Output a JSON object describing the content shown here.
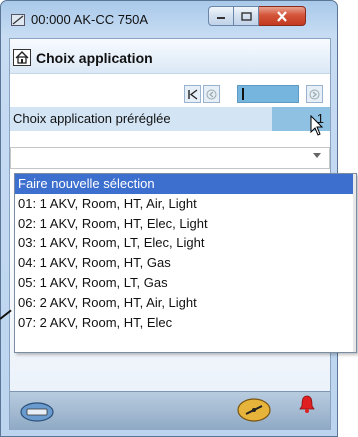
{
  "window": {
    "title": "00:000 AK-CC 750A",
    "caption_buttons": [
      "minimize",
      "maximize",
      "close"
    ]
  },
  "header": {
    "title": "Choix application",
    "home_icon": "home-icon"
  },
  "nav": {
    "buttons": [
      "first-page-icon",
      "prev-page-icon",
      "next-page-icon"
    ]
  },
  "parameter": {
    "label": "Choix application préréglée",
    "value": "1"
  },
  "combo": {
    "value": ""
  },
  "dropdown": {
    "selected_index": 0,
    "items": [
      "Faire nouvelle sélection",
      "01: 1 AKV, Room, HT, Air, Light",
      "02: 1 AKV, Room, HT, Elec, Light",
      "03: 1 AKV, Room, LT, Elec, Light",
      "04: 1 AKV, Room, HT, Gas",
      "05: 1 AKV, Room, LT, Gas",
      "06: 2 AKV, Room, HT, Air, Light",
      "07: 2 AKV, Room, HT, Elec"
    ]
  },
  "colors": {
    "selection": "#3d6fce",
    "param_row": "#d3e4f4",
    "value_cell": "#8fc1e3",
    "alarm": "#e02020"
  }
}
